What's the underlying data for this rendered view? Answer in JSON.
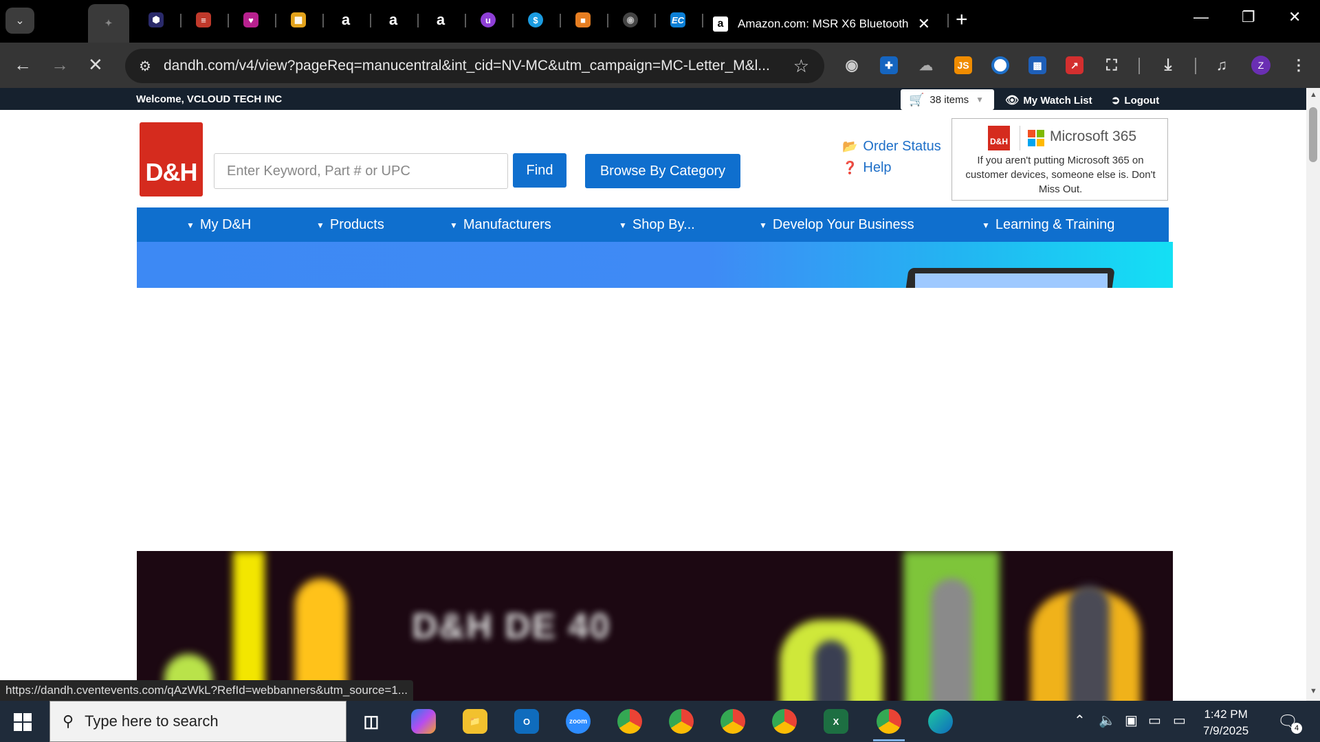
{
  "browser": {
    "active_tab_title": "Amazon.com: MSR X6 Bluetooth",
    "active_tab_favicon": "a",
    "url": "dandh.com/v4/view?pageReq=manucentral&int_cid=NV-MC&utm_campaign=MC-Letter_M&l...",
    "pinned_tab_icons": [
      "loading-icon",
      "cube-icon",
      "layers-icon",
      "heart-icon",
      "notebook-icon",
      "amazon-icon",
      "amazon-icon",
      "amazon-icon",
      "u-icon",
      "dollar-icon",
      "box-icon",
      "globe-icon",
      "ec-icon"
    ],
    "ec_label": "EC",
    "js_label": "JS",
    "profile_initial": "Z",
    "status_url": "https://dandh.cventevents.com/qAzWkL?RefId=webbanners&utm_source=1..."
  },
  "header": {
    "welcome": "Welcome, VCLOUD TECH INC",
    "cart_label": "38 items",
    "watch_list": "My Watch List",
    "logout": "Logout",
    "logo_text": "D&H",
    "search_placeholder": "Enter Keyword, Part # or UPC",
    "find_label": "Find",
    "browse_label": "Browse By Category",
    "order_status": "Order Status",
    "help": "Help"
  },
  "ad": {
    "brand_logo": "D&H",
    "title": "Microsoft 365",
    "text": "If you aren't putting Microsoft 365 on customer devices, someone else is. Don't Miss Out.",
    "ms_colors": [
      "#f25022",
      "#7fba00",
      "#00a4ef",
      "#ffb900"
    ]
  },
  "nav": {
    "items": [
      "My D&H",
      "Products",
      "Manufacturers",
      "Shop By...",
      "Develop Your Business",
      "Learning & Training"
    ]
  },
  "banner": {
    "logo_text": "D&H DE 40"
  },
  "taskbar": {
    "search_placeholder": "Type here to search",
    "zoom_label": "zoom",
    "time": "1:42 PM",
    "date": "7/9/2025",
    "notification_count": "4"
  },
  "colors": {
    "brand_red": "#d52b1e",
    "brand_blue": "#0f6fce",
    "link_blue": "#1e6fc8",
    "top_bar": "#16212e"
  }
}
